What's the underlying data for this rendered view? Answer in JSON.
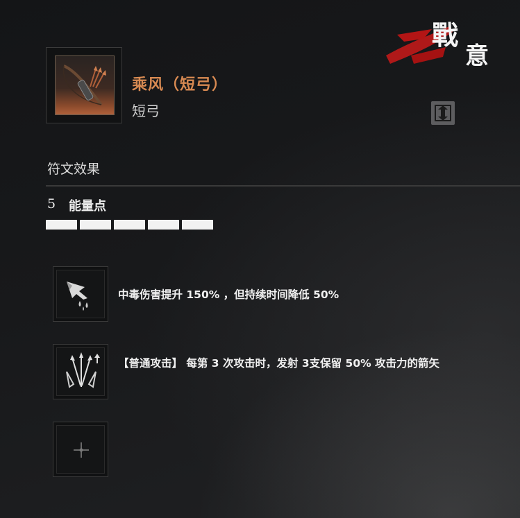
{
  "logo": {
    "text": "戰意"
  },
  "item": {
    "name": "乘风（短弓）",
    "type": "短弓"
  },
  "swap_icon": "swap-arrows-icon",
  "rune_section": {
    "title": "符文效果",
    "energy_value": "5",
    "energy_label": "能量点",
    "energy_pips_filled": 5,
    "energy_pips_total": 5
  },
  "runes": [
    {
      "icon": "poison-arrowhead-icon",
      "text": "中毒伤害提升 150% ，但持续时间降低 50%"
    },
    {
      "icon": "triple-arrow-icon",
      "text": "【普通攻击】 每第 3 次攻击时，发射 3支保留 50% 攻击力的箭矢"
    },
    {
      "icon": "empty-slot-plus-icon",
      "text": ""
    }
  ],
  "colors": {
    "item_name": "#d88a52",
    "logo_red": "#c01a1a"
  }
}
